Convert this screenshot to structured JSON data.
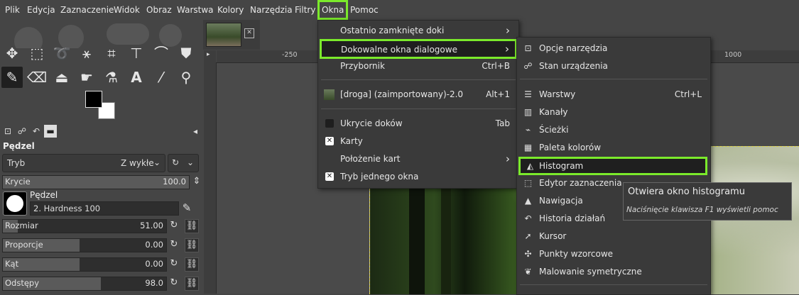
{
  "menubar": [
    "Plik",
    "Edycja",
    "Zaznaczenie",
    "Widok",
    "Obraz",
    "Warstwa",
    "Kolory",
    "Narzędzia",
    "Filtry",
    "Okna",
    "Pomoc"
  ],
  "colors": {
    "highlight": "#7bea2b",
    "background": "#454545",
    "menu": "#3a3a3a"
  },
  "tools": [
    "move-icon",
    "rect-select-icon",
    "lasso-icon",
    "fuzzy-select-icon",
    "crop-icon",
    "transform-icon",
    "warp-icon",
    "bucket-fill-icon",
    "paintbrush-icon",
    "eraser-icon",
    "clone-icon",
    "smudge-icon",
    "airbrush-icon",
    "text-icon",
    "color-picker-icon",
    "zoom-icon"
  ],
  "tool_options": {
    "title": "Pędzel",
    "mode_label": "Tryb",
    "mode_value": "Z wykłe",
    "opacity_label": "Krycie",
    "opacity_value": "100.0",
    "brush_label": "Pędzel",
    "brush_value": "2. Hardness 100",
    "sliders": [
      {
        "label": "Rozmiar",
        "value": "51.00",
        "fill": 0.09
      },
      {
        "label": "Proporcje",
        "value": "0.00",
        "fill": 0.47
      },
      {
        "label": "Kąt",
        "value": "0.00",
        "fill": 0.47
      },
      {
        "label": "Odstępy",
        "value": "98.0",
        "fill": 0.6
      }
    ]
  },
  "ruler": {
    "left": "-250",
    "right": "1000"
  },
  "windows_menu": [
    {
      "label": "Ostatnio zamknięte doki",
      "accel": "›"
    },
    {
      "label": "Dokowalne okna dialogowe",
      "accel": "›",
      "highlight": true
    },
    {
      "label": "Przybornik",
      "accel": "Ctrl+B"
    },
    {
      "label": "[droga] (zaimportowany)-2.0",
      "accel": "Alt+1"
    },
    {
      "label": "Ukrycie doków",
      "accel": "Tab"
    },
    {
      "label": "Karty",
      "accel": ""
    },
    {
      "label": "Położenie kart",
      "accel": "›"
    },
    {
      "label": "Tryb jednego okna",
      "accel": ""
    }
  ],
  "dockable_menu": [
    {
      "label": "Opcje narzędzia",
      "icon": "tool-options-icon"
    },
    {
      "label": "Stan urządzenia",
      "icon": "device-status-icon"
    },
    {
      "label": "Warstwy",
      "accel": "Ctrl+L",
      "icon": "layers-icon"
    },
    {
      "label": "Kanały",
      "icon": "channels-icon"
    },
    {
      "label": "Ścieżki",
      "icon": "paths-icon"
    },
    {
      "label": "Paleta kolorów",
      "icon": "palette-icon"
    },
    {
      "label": "Histogram",
      "icon": "histogram-icon",
      "highlight": true
    },
    {
      "label": "Edytor zaznaczenia",
      "icon": "selection-editor-icon"
    },
    {
      "label": "Nawigacja",
      "icon": "navigation-icon"
    },
    {
      "label": "Historia działań",
      "icon": "undo-history-icon"
    },
    {
      "label": "Kursor",
      "icon": "pointer-icon"
    },
    {
      "label": "Punkty wzorcowe",
      "icon": "sample-points-icon"
    },
    {
      "label": "Malowanie symetryczne",
      "icon": "symmetry-icon"
    }
  ],
  "tooltip": {
    "title": "Otwiera okno histogramu",
    "hint": "Naciśnięcie klawisza F1 wyświetli pomoc"
  }
}
